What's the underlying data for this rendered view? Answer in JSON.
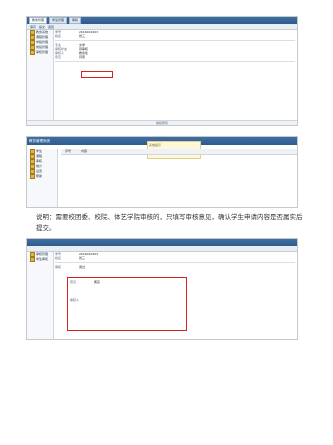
{
  "screen1": {
    "tabs": [
      "教务管理",
      "学生管理",
      "审核"
    ],
    "toolbar": [
      "保存",
      "提交",
      "返回"
    ],
    "tree": [
      "教务系统",
      "课程管理",
      "学籍管理",
      "成绩管理",
      "审核管理"
    ],
    "rows": [
      {
        "label": "学号",
        "value": "2016010203"
      },
      {
        "label": "姓名",
        "value": "张三"
      },
      {
        "label": "专业",
        "value": "文学"
      },
      {
        "label": "审核状态",
        "value": "待审核"
      },
      {
        "label": "审核人",
        "value": "教务处"
      },
      {
        "label": "意见",
        "value": "同意"
      }
    ],
    "footer": "版权所有"
  },
  "screen2": {
    "header": "教务管理系统",
    "tree": [
      "学生",
      "课程",
      "审核",
      "统计",
      "设置",
      "帮助"
    ],
    "columns": [
      "序号",
      "内容"
    ],
    "status": "系统提示"
  },
  "caption": "说明：需要校团委、校院、体艺学院审核的，只填写审核意见，确认学生申请内容是否属实后提交。",
  "screen3": {
    "tree": [
      "审核管理",
      "学生审核"
    ],
    "rows": [
      {
        "label": "学号",
        "value": "2016010203"
      },
      {
        "label": "姓名",
        "value": "张三"
      },
      {
        "label": "审核",
        "value": "通过"
      },
      {
        "label": "意见",
        "value": "属实"
      },
      {
        "label": "审核人",
        "value": "校团委"
      }
    ]
  }
}
